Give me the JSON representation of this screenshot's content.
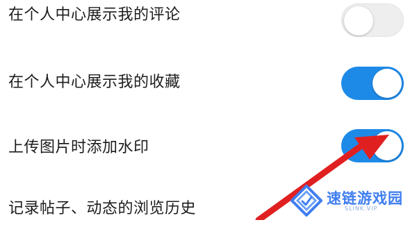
{
  "settings": {
    "items": [
      {
        "label": "在个人中心展示我的评论",
        "toggle_state": "off"
      },
      {
        "label": "在个人中心展示我的收藏",
        "toggle_state": "on"
      },
      {
        "label": "上传图片时添加水印",
        "toggle_state": "on"
      },
      {
        "label": "记录帖子、动态的浏览历史"
      }
    ]
  },
  "colors": {
    "toggle_on": "#1e8ae8",
    "toggle_off": "#eeeeee",
    "arrow": "#e02020",
    "watermark": "#3f7ef0"
  },
  "overlay": {
    "arrow_icon": "red-arrow-icon"
  },
  "watermark": {
    "title": "速链游戏园",
    "subtitle": "SLINK.VIP",
    "logo_icon": "diamond-logo-icon"
  }
}
